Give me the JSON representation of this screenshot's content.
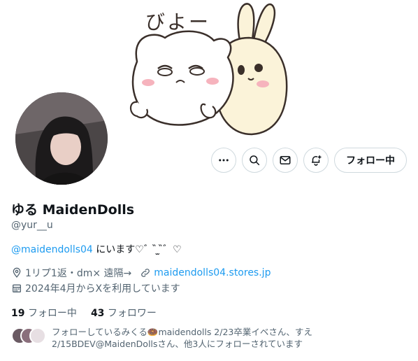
{
  "banner": {
    "text": "びよー"
  },
  "profile": {
    "display_name": "ゆる MaidenDolls",
    "handle": "@yur__u",
    "bio_mention": "@maidendolls04",
    "bio_text": " にいます♡゛ ̏ ̫ ̏゛♡",
    "location": "1リプ1返・dm× 遠隔→",
    "website": "maidendolls04.stores.jp",
    "joined": "2024年4月からXを利用しています"
  },
  "actions": {
    "follow_label": "フォロー中"
  },
  "counts": {
    "following_num": "19",
    "following_label": "フォロー中",
    "followers_num": "43",
    "followers_label": "フォロワー"
  },
  "followed_by": {
    "line1": "フォローしているみくる🍩maidendolls 2/23卒業イベさん、すえ",
    "line2": "2/15BDEV@MaidenDollsさん、他3人にフォローされています"
  },
  "colors": {
    "accent": "#1d9bf0",
    "muted": "#536471",
    "text": "#0f1419"
  }
}
